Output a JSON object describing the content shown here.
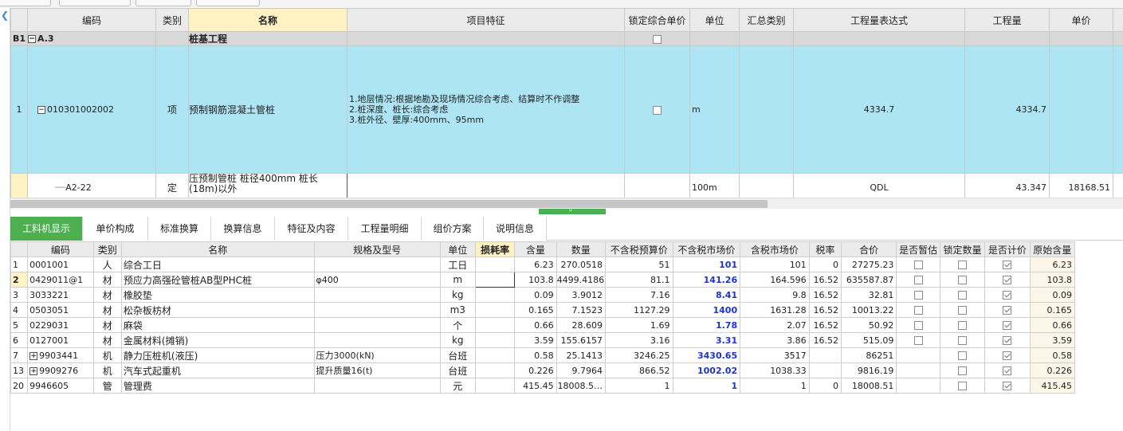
{
  "upper_table": {
    "headers": {
      "code": "编码",
      "category": "类别",
      "name": "名称",
      "features": "项目特征",
      "lock_price": "锁定综合单价",
      "unit": "单位",
      "summary_category": "汇总类别",
      "qty_expr": "工程量表达式",
      "qty": "工程量",
      "unit_price": "单价"
    },
    "group_row": {
      "id": "B1",
      "code": "A.3",
      "name": "桩基工程"
    },
    "main_row": {
      "num": "1",
      "code": "010301002002",
      "category": "项",
      "name": "预制钢筋混凝土管桩",
      "features": [
        "1.地层情况:根据地勘及现场情况综合考虑、结算时不作调整",
        "2.桩深度、桩长:综合考虑",
        "3.桩外径、壁厚:400mm、95mm"
      ],
      "unit": "m",
      "qty_expr": "4334.7",
      "qty": "4334.7",
      "expand_sign": "−"
    },
    "sub_row": {
      "code": "A2-22",
      "category": "定",
      "name": "压预制管桩 桩径400mm 桩长(18m)以外",
      "unit": "100m",
      "qty_expr": "QDL",
      "qty": "43.347",
      "unit_price": "18168.51"
    }
  },
  "tabs": [
    "工料机显示",
    "单价构成",
    "标准换算",
    "换算信息",
    "特征及内容",
    "工程量明细",
    "组价方案",
    "说明信息"
  ],
  "lower_table": {
    "headers": {
      "code": "编码",
      "category": "类别",
      "name": "名称",
      "spec": "规格及型号",
      "unit": "单位",
      "loss": "损耗率",
      "content": "含量",
      "quantity": "数量",
      "pre_tax_budget": "不含税预算价",
      "pre_tax_market": "不含税市场价",
      "tax_market": "含税市场价",
      "tax_rate": "税率",
      "total": "合价",
      "is_estimate": "是否暂估",
      "lock_qty": "锁定数量",
      "is_priced": "是否计价",
      "orig_content": "原始含量"
    },
    "rows": [
      {
        "num": "1",
        "code": "0001001",
        "cat": "人",
        "name": "综合工日",
        "spec": "",
        "unit": "工日",
        "loss": "",
        "content": "6.23",
        "quantity": "270.0518",
        "budget": "51",
        "market": "101",
        "tax_market": "101",
        "tax_rate": "0",
        "total": "27275.23",
        "estimate": false,
        "lock": false,
        "priced": true,
        "orig": "6.23",
        "expand": false
      },
      {
        "num": "2",
        "code": "0429011@1",
        "cat": "材",
        "name": "预应力高强砼管桩AB型PHC桩",
        "spec": "φ400",
        "unit": "m",
        "loss": "",
        "content": "103.8",
        "quantity": "4499.4186",
        "budget": "81.1",
        "market": "141.26",
        "tax_market": "164.596",
        "tax_rate": "16.52",
        "total": "635587.87",
        "estimate": false,
        "lock": false,
        "priced": true,
        "orig": "103.8",
        "expand": false
      },
      {
        "num": "3",
        "code": "3033221",
        "cat": "材",
        "name": "橡胶垫",
        "spec": "",
        "unit": "kg",
        "loss": "",
        "content": "0.09",
        "quantity": "3.9012",
        "budget": "7.16",
        "market": "8.41",
        "tax_market": "9.8",
        "tax_rate": "16.52",
        "total": "32.81",
        "estimate": false,
        "lock": false,
        "priced": true,
        "orig": "0.09",
        "expand": false
      },
      {
        "num": "4",
        "code": "0503051",
        "cat": "材",
        "name": "松杂板枋材",
        "spec": "",
        "unit": "m3",
        "loss": "",
        "content": "0.165",
        "quantity": "7.1523",
        "budget": "1127.29",
        "market": "1400",
        "tax_market": "1631.28",
        "tax_rate": "16.52",
        "total": "10013.22",
        "estimate": false,
        "lock": false,
        "priced": true,
        "orig": "0.165",
        "expand": false
      },
      {
        "num": "5",
        "code": "0229031",
        "cat": "材",
        "name": "麻袋",
        "spec": "",
        "unit": "个",
        "loss": "",
        "content": "0.66",
        "quantity": "28.609",
        "budget": "1.69",
        "market": "1.78",
        "tax_market": "2.07",
        "tax_rate": "16.52",
        "total": "50.92",
        "estimate": false,
        "lock": false,
        "priced": true,
        "orig": "0.66",
        "expand": false
      },
      {
        "num": "6",
        "code": "0127001",
        "cat": "材",
        "name": "金属材料(摊销)",
        "spec": "",
        "unit": "kg",
        "loss": "",
        "content": "3.59",
        "quantity": "155.6157",
        "budget": "3.16",
        "market": "3.31",
        "tax_market": "3.86",
        "tax_rate": "16.52",
        "total": "515.09",
        "estimate": false,
        "lock": false,
        "priced": true,
        "orig": "3.59",
        "expand": false
      },
      {
        "num": "7",
        "code": "9903441",
        "cat": "机",
        "name": "静力压桩机(液压)",
        "spec": "压力3000(kN)",
        "unit": "台班",
        "loss": "",
        "content": "0.58",
        "quantity": "25.1413",
        "budget": "3246.25",
        "market": "3430.65",
        "tax_market": "3517",
        "tax_rate": "",
        "total": "86251",
        "estimate": null,
        "lock": false,
        "priced": true,
        "orig": "0.58",
        "expand": true
      },
      {
        "num": "13",
        "code": "9909276",
        "cat": "机",
        "name": "汽车式起重机",
        "spec": "提升质量16(t)",
        "unit": "台班",
        "loss": "",
        "content": "0.226",
        "quantity": "9.7964",
        "budget": "866.52",
        "market": "1002.02",
        "tax_market": "1038.33",
        "tax_rate": "",
        "total": "9816.19",
        "estimate": null,
        "lock": false,
        "priced": true,
        "orig": "0.226",
        "expand": true
      },
      {
        "num": "20",
        "code": "9946605",
        "cat": "管",
        "name": "管理费",
        "spec": "",
        "unit": "元",
        "loss": "",
        "content": "415.45",
        "quantity": "18008.5…",
        "budget": "1",
        "market": "1",
        "tax_market": "1",
        "tax_rate": "0",
        "total": "18008.51",
        "estimate": null,
        "lock": false,
        "priced": true,
        "orig": "415.45",
        "expand": false
      }
    ]
  },
  "colors": {
    "main_row_bg": "#ade5f5",
    "active_tab": "#4caf50",
    "highlight_header": "#fff2c2",
    "market_price_text": "#1e34c8"
  }
}
